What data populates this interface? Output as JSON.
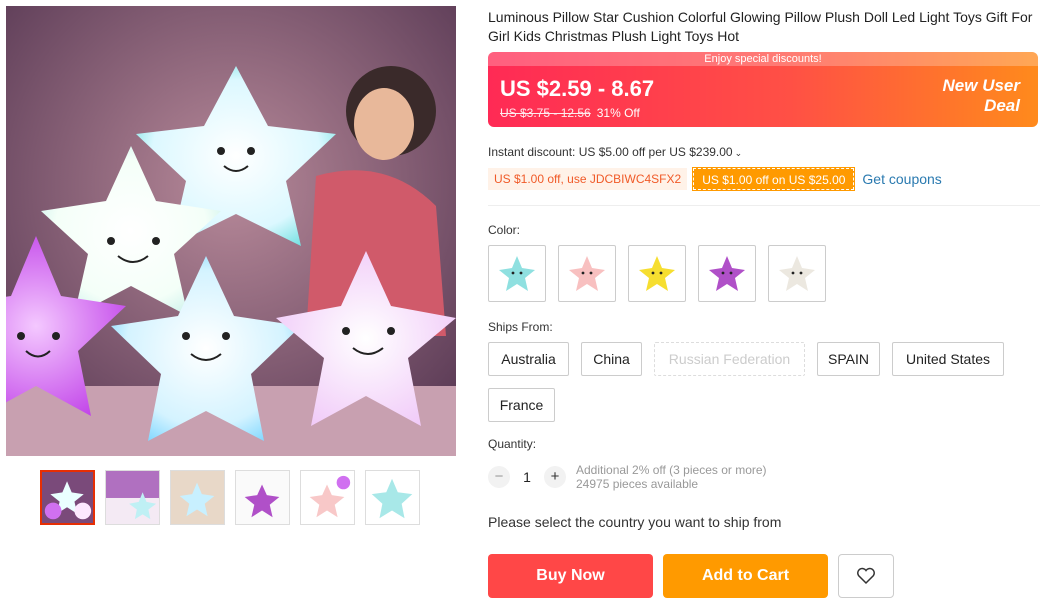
{
  "product": {
    "title": "Luminous Pillow Star Cushion Colorful Glowing Pillow Plush Doll Led Light Toys Gift For Girl Kids Christmas Plush Light Toys Hot"
  },
  "gallery": {
    "thumb_count": 6
  },
  "price": {
    "banner_top": "Enjoy special discounts!",
    "current": "US $2.59 - 8.67",
    "original": "US $3.75 - 12.56",
    "discount": "31% Off",
    "new_user_line1": "New User",
    "new_user_line2": "Deal"
  },
  "instant_discount": "Instant discount: US $5.00 off per US $239.00",
  "coupons": {
    "code_coupon": "US $1.00 off, use JDCBIWC4SFX2",
    "store_coupon": "US $1.00 off on US $25.00",
    "get_coupons": "Get coupons"
  },
  "color": {
    "label": "Color:",
    "options": [
      "teal-star",
      "pink-star",
      "yellow-star",
      "purple-star",
      "white-star"
    ]
  },
  "ships_from": {
    "label": "Ships From:",
    "options": [
      "Australia",
      "China",
      "Russian Federation",
      "SPAIN",
      "United States",
      "France"
    ]
  },
  "quantity": {
    "label": "Quantity:",
    "value": "1",
    "minus": "−",
    "plus": "+",
    "additional": "Additional 2% off (3 pieces or more)",
    "available": "24975 pieces available"
  },
  "ship_notice": "Please select the country you want to ship from",
  "actions": {
    "buy_now": "Buy Now",
    "add_to_cart": "Add to Cart"
  },
  "colors": {
    "accent_red": "#ff4747",
    "accent_orange": "#ff9a00",
    "link_blue": "#2a7ab0"
  }
}
